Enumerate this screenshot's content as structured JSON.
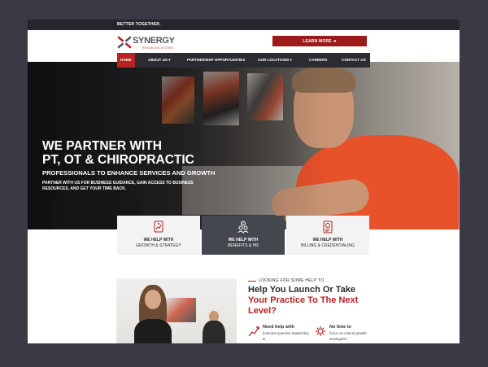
{
  "topbar": {
    "tagline": "BETTER TOGETHER."
  },
  "header": {
    "logo_text": "SYNERGY",
    "logo_sub": "REHAB SOLUTIONS",
    "cta": "LEARN MORE ➔"
  },
  "nav": {
    "items": [
      {
        "label": "HOME"
      },
      {
        "label": "ABOUT US ▾"
      },
      {
        "label": "PARTNERSHIP OPPORTUNITIES"
      },
      {
        "label": "OUR LOCATIONS ▾"
      },
      {
        "label": "CAREERS"
      },
      {
        "label": "CONTACT US"
      }
    ]
  },
  "hero": {
    "line1": "WE PARTNER WITH",
    "line2": "PT, OT & CHIROPRACTIC",
    "subtitle": "PROFESSIONALS TO ENHANCE SERVICES AND GROWTH",
    "body": "PARTNER WITH US FOR BUSINESS GUIDANCE, GAIN ACCESS TO BUSINESS RESOURCES, AND GET YOUR TIME BACK."
  },
  "services": [
    {
      "l1": "WE HELP WITH",
      "l2": "GROWTH & STRATEGY",
      "icon": "growth-chart-icon"
    },
    {
      "l1": "WE HELP WITH",
      "l2": "BENEFITS & HR",
      "icon": "people-dollar-icon"
    },
    {
      "l1": "WE HELP WITH",
      "l2": "BILLING & CREDENTIALING",
      "icon": "billing-document-icon"
    }
  ],
  "section": {
    "eyebrow": "LOOKING FOR SOME HELP TO",
    "head1": "Help You Launch Or Take",
    "head2": "Your Practice To The Next",
    "head3": "Level?",
    "features": [
      {
        "title": "Need help with",
        "text": "business practice leadership &",
        "icon": "chart-growth-icon"
      },
      {
        "title": "No time to",
        "text": "focus on critical growth strategies?",
        "icon": "gear-cycle-icon"
      }
    ]
  },
  "colors": {
    "accent": "#b42222",
    "dark": "#2b2c31",
    "page_bg": "#3a3a44"
  }
}
